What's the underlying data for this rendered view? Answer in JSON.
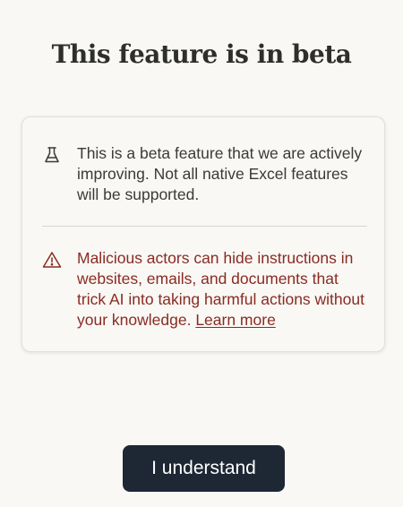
{
  "dialog": {
    "title": "This feature is in beta",
    "beta_notice": {
      "icon": "flask-icon",
      "text": "This is a beta feature that we are actively improving. Not all native Excel features will be supported."
    },
    "warning_notice": {
      "icon": "warning-triangle-icon",
      "text": "Malicious actors can hide instructions in websites, emails, and documents that trick AI into taking harmful actions without your knowledge. ",
      "link_label": "Learn more"
    },
    "confirm_button_label": "I understand"
  },
  "colors": {
    "background": "#f9f8f5",
    "warning_text": "#8a2b22",
    "button_background": "#1e2734"
  }
}
